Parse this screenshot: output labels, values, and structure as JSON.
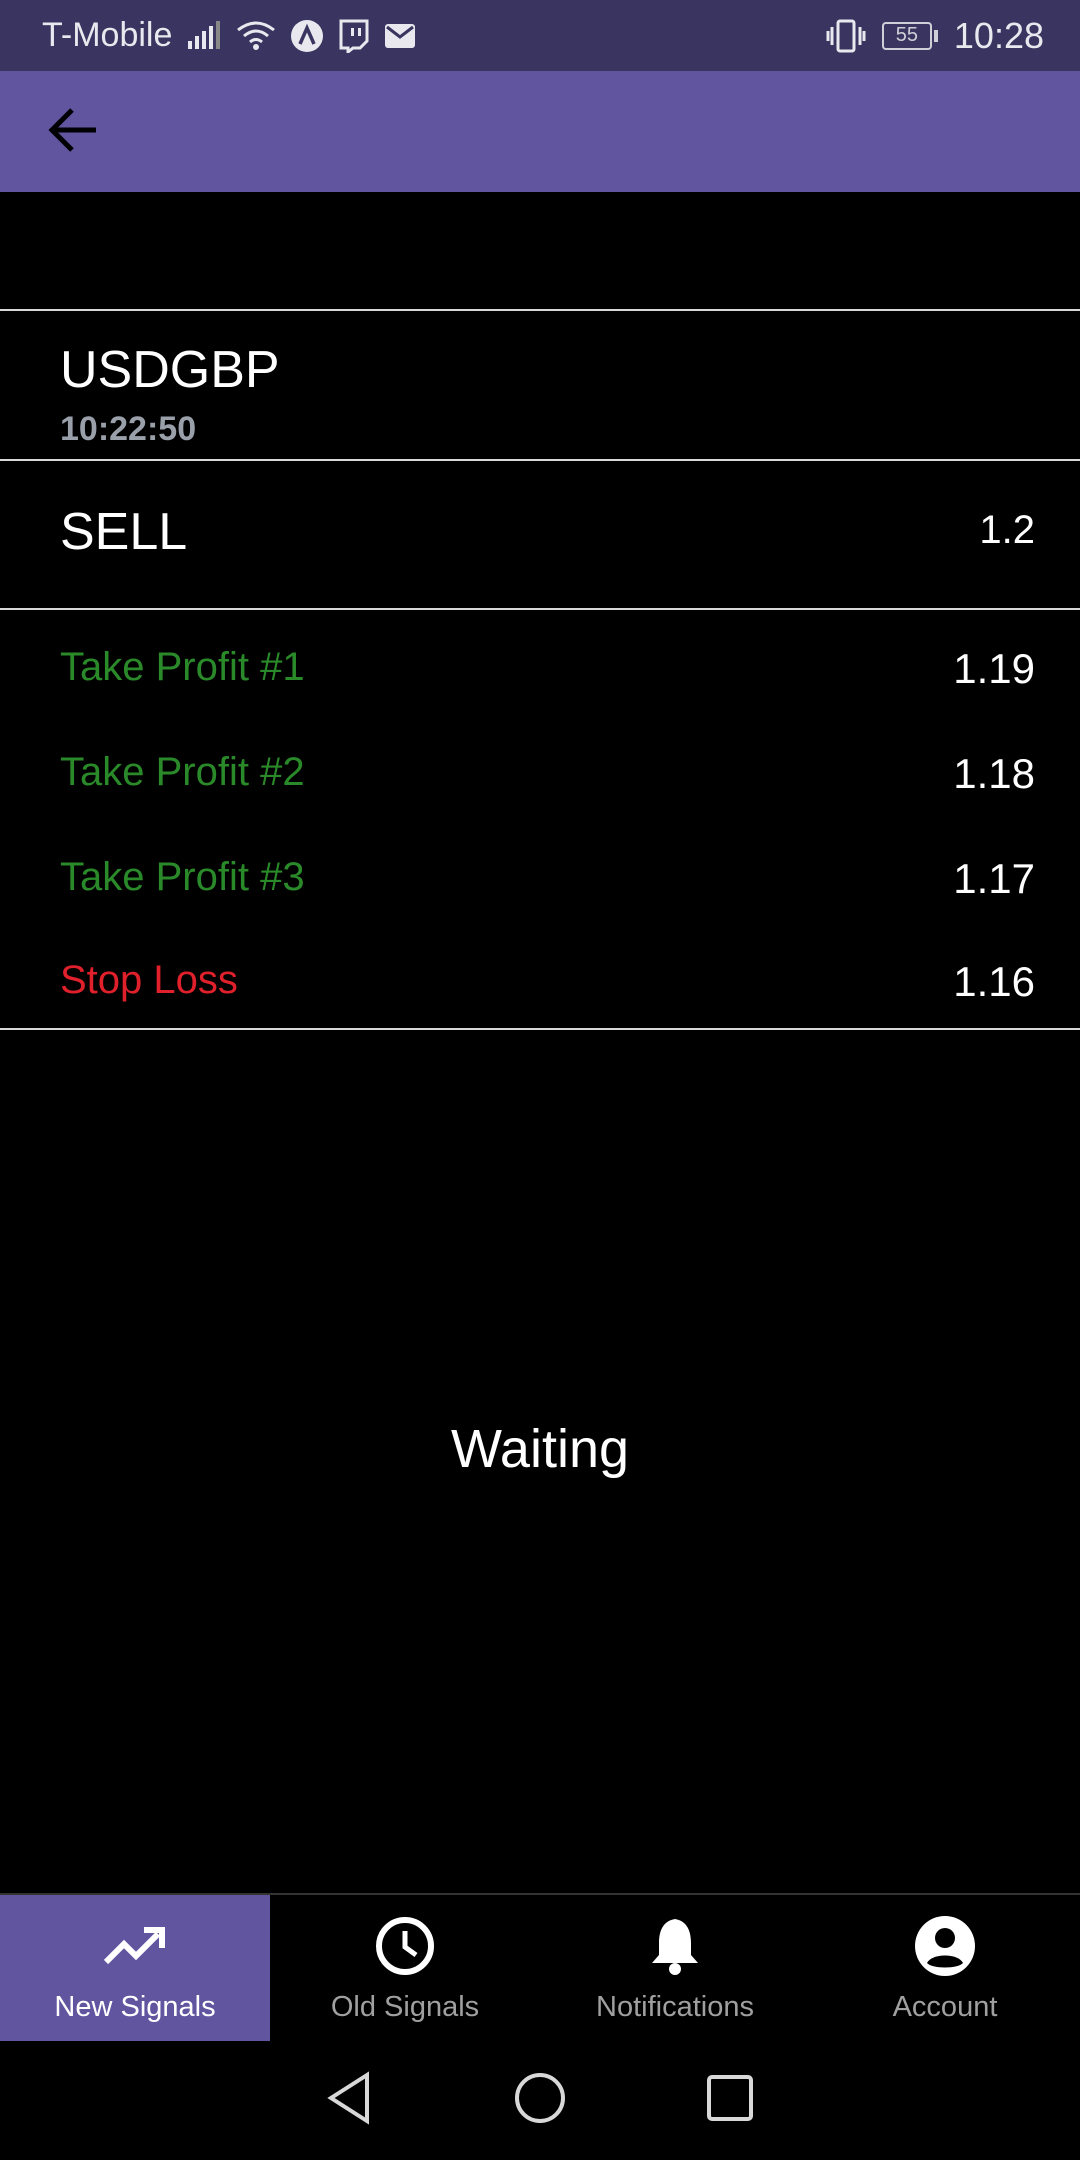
{
  "status_bar": {
    "carrier": "T-Mobile",
    "battery_level": "55",
    "time": "10:28"
  },
  "signal": {
    "pair": "USDGBP",
    "time": "10:22:50",
    "action": "SELL",
    "entry": "1.2",
    "levels": [
      {
        "label": "Take Profit #1",
        "value": "1.19",
        "color": "#2a8a2a"
      },
      {
        "label": "Take Profit #2",
        "value": "1.18",
        "color": "#2a8a2a"
      },
      {
        "label": "Take Profit #3",
        "value": "1.17",
        "color": "#2a8a2a"
      },
      {
        "label": "Stop Loss",
        "value": "1.16",
        "color": "#e0202a"
      }
    ],
    "status": "Waiting"
  },
  "bottom_nav": {
    "items": [
      {
        "label": "New Signals",
        "icon": "trending-up-icon",
        "active": true
      },
      {
        "label": "Old Signals",
        "icon": "clock-icon",
        "active": false
      },
      {
        "label": "Notifications",
        "icon": "bell-icon",
        "active": false
      },
      {
        "label": "Account",
        "icon": "account-circle-icon",
        "active": false
      }
    ]
  },
  "colors": {
    "appbar": "#6155a0",
    "statusbar": "#3a3560",
    "take_profit": "#2a8a2a",
    "stop_loss": "#e0202a"
  }
}
